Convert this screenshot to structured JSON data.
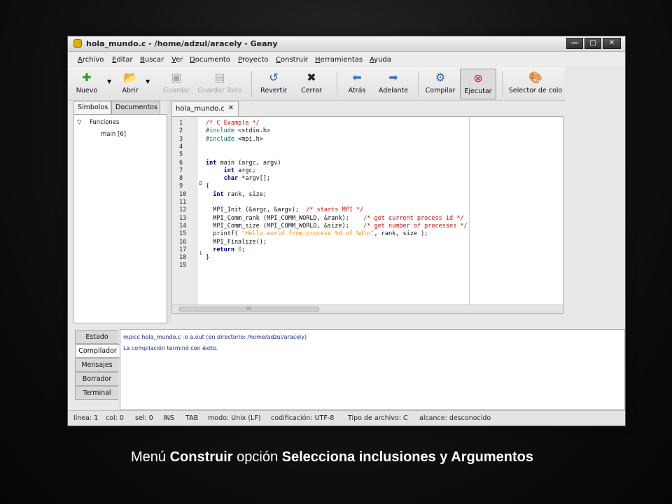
{
  "window": {
    "title": "hola_mundo.c - /home/adzul/aracely - Geany",
    "controls": {
      "minimize": "—",
      "maximize": "▢",
      "close": "✕"
    }
  },
  "menu": [
    "Archivo",
    "Editar",
    "Buscar",
    "Ver",
    "Documento",
    "Proyecto",
    "Construir",
    "Herramientas",
    "Ayuda"
  ],
  "toolbar": {
    "nuevo": "Nuevo",
    "abrir": "Abrir",
    "guardar": "Guardar",
    "guardar_todo": "Guardar Todo",
    "revertir": "Revertir",
    "cerrar": "Cerrar",
    "atras": "Atrás",
    "adelante": "Adelante",
    "compilar": "Compilar",
    "ejecutar": "Ejecutar",
    "selector_color": "Selector de colo"
  },
  "sidebar": {
    "tabs": [
      "Símbolos",
      "Documentos"
    ],
    "tree": {
      "group": "Funciones",
      "item": "main [6]"
    }
  },
  "editor": {
    "tab_label": "hola_mundo.c",
    "scroll_marker": "III"
  },
  "code_lines": [
    {
      "n": "1",
      "html": "<span class='cm'>/* C Example */</span>"
    },
    {
      "n": "2",
      "html": "<span class='pp'>#include</span> &lt;stdio.h&gt;"
    },
    {
      "n": "3",
      "html": "<span class='pp'>#include</span> &lt;mpi.h&gt;"
    },
    {
      "n": "4",
      "html": ""
    },
    {
      "n": "5",
      "html": ""
    },
    {
      "n": "6",
      "html": "<span class='kw'>int</span> main (argc, argv)"
    },
    {
      "n": "7",
      "html": "     <span class='kw'>int</span> argc;"
    },
    {
      "n": "8",
      "html": "     <span class='kw'>char</span> *argv[];"
    },
    {
      "n": "9",
      "html": "{"
    },
    {
      "n": "10",
      "html": "  <span class='kw'>int</span> rank, size;"
    },
    {
      "n": "11",
      "html": ""
    },
    {
      "n": "12",
      "html": "  MPI_Init (&amp;argc, &amp;argv);  <span class='cm'>/* starts MPI */</span>"
    },
    {
      "n": "13",
      "html": "  MPI_Comm_rank (MPI_COMM_WORLD, &amp;rank);    <span class='cm'>/* get current process id */</span>"
    },
    {
      "n": "14",
      "html": "  MPI_Comm_size (MPI_COMM_WORLD, &amp;size);    <span class='cm'>/* get number of processes */</span>"
    },
    {
      "n": "15",
      "html": "  printf( <span class='st'>\"Hello world from process %d of %d\\n\"</span>, rank, size );"
    },
    {
      "n": "16",
      "html": "  MPI_Finalize();"
    },
    {
      "n": "17",
      "html": "  <span class='kw'>return</span> <span class='nm'>0</span>;"
    },
    {
      "n": "18",
      "html": "}"
    },
    {
      "n": "19",
      "html": ""
    }
  ],
  "bottom_tabs": [
    "Estado",
    "Compilador",
    "Mensajes",
    "Borrador",
    "Terminal"
  ],
  "messages": [
    "mpicc hola_mundo.c -o a.out (en directorio: /home/adzul/aracely)",
    "La compilación terminó con éxito."
  ],
  "status": {
    "linea": "línea: 1",
    "col": "col: 0",
    "sel": "sel: 0",
    "ins": "INS",
    "tab": "TAB",
    "modo": "modo: Unix (LF)",
    "codificacion": "codificación: UTF-8",
    "tipo": "Tipo de archivo: C",
    "alcance": "alcance: desconocido"
  },
  "caption": {
    "p1": "Menú ",
    "b1": "Construir",
    "p2": " opción ",
    "b2": "Selecciona inclusiones y Argumentos"
  }
}
